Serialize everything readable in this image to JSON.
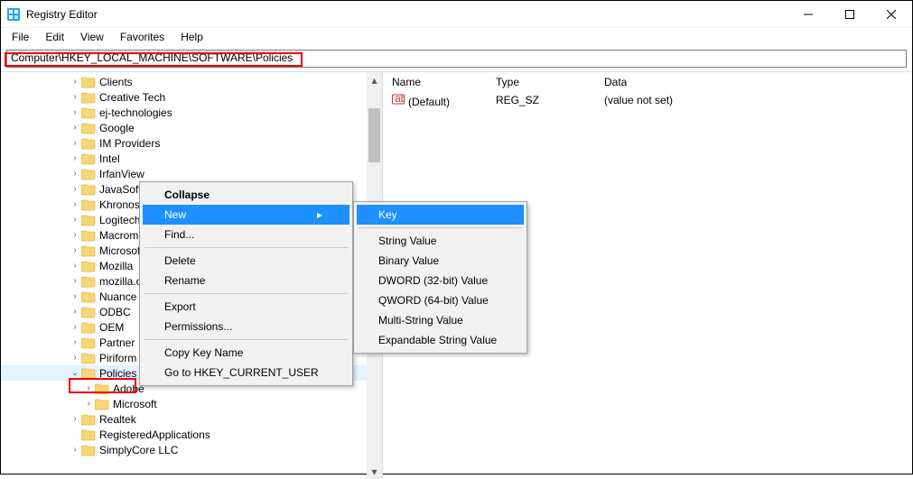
{
  "window": {
    "title": "Registry Editor"
  },
  "menubar": {
    "file": "File",
    "edit": "Edit",
    "view": "View",
    "favorites": "Favorites",
    "help": "Help"
  },
  "address": {
    "path": "Computer\\HKEY_LOCAL_MACHINE\\SOFTWARE\\Policies"
  },
  "tree": {
    "items": [
      {
        "indent": 5,
        "expand": ">",
        "label": "Clients"
      },
      {
        "indent": 5,
        "expand": ">",
        "label": "Creative Tech"
      },
      {
        "indent": 5,
        "expand": ">",
        "label": "ej-technologies"
      },
      {
        "indent": 5,
        "expand": ">",
        "label": "Google"
      },
      {
        "indent": 5,
        "expand": ">",
        "label": "IM Providers"
      },
      {
        "indent": 5,
        "expand": ">",
        "label": "Intel"
      },
      {
        "indent": 5,
        "expand": ">",
        "label": "IrfanView"
      },
      {
        "indent": 5,
        "expand": ">",
        "label": "JavaSoft"
      },
      {
        "indent": 5,
        "expand": ">",
        "label": "Khronos"
      },
      {
        "indent": 5,
        "expand": ">",
        "label": "Logitech"
      },
      {
        "indent": 5,
        "expand": ">",
        "label": "Macromedia"
      },
      {
        "indent": 5,
        "expand": ">",
        "label": "Microsoft"
      },
      {
        "indent": 5,
        "expand": ">",
        "label": "Mozilla"
      },
      {
        "indent": 5,
        "expand": ">",
        "label": "mozilla.org"
      },
      {
        "indent": 5,
        "expand": ">",
        "label": "Nuance"
      },
      {
        "indent": 5,
        "expand": ">",
        "label": "ODBC"
      },
      {
        "indent": 5,
        "expand": ">",
        "label": "OEM"
      },
      {
        "indent": 5,
        "expand": ">",
        "label": "Partner"
      },
      {
        "indent": 5,
        "expand": ">",
        "label": "Piriform"
      },
      {
        "indent": 5,
        "expand": "v",
        "label": "Policies",
        "selected": true
      },
      {
        "indent": 6,
        "expand": ">",
        "label": "Adobe"
      },
      {
        "indent": 6,
        "expand": ">",
        "label": "Microsoft"
      },
      {
        "indent": 5,
        "expand": ">",
        "label": "Realtek"
      },
      {
        "indent": 5,
        "expand": " ",
        "label": "RegisteredApplications"
      },
      {
        "indent": 5,
        "expand": ">",
        "label": "SimplyCore LLC"
      }
    ]
  },
  "list": {
    "headers": {
      "name": "Name",
      "type": "Type",
      "data": "Data"
    },
    "rows": [
      {
        "name": "(Default)",
        "type": "REG_SZ",
        "data": "(value not set)"
      }
    ]
  },
  "context_menu": {
    "collapse": "Collapse",
    "new": "New",
    "find": "Find...",
    "delete": "Delete",
    "rename": "Rename",
    "export": "Export",
    "permissions": "Permissions...",
    "copy_key_name": "Copy Key Name",
    "goto_hkcu": "Go to HKEY_CURRENT_USER"
  },
  "submenu_new": {
    "key": "Key",
    "string": "String Value",
    "binary": "Binary Value",
    "dword": "DWORD (32-bit) Value",
    "qword": "QWORD (64-bit) Value",
    "multi_string": "Multi-String Value",
    "exp_string": "Expandable String Value"
  }
}
